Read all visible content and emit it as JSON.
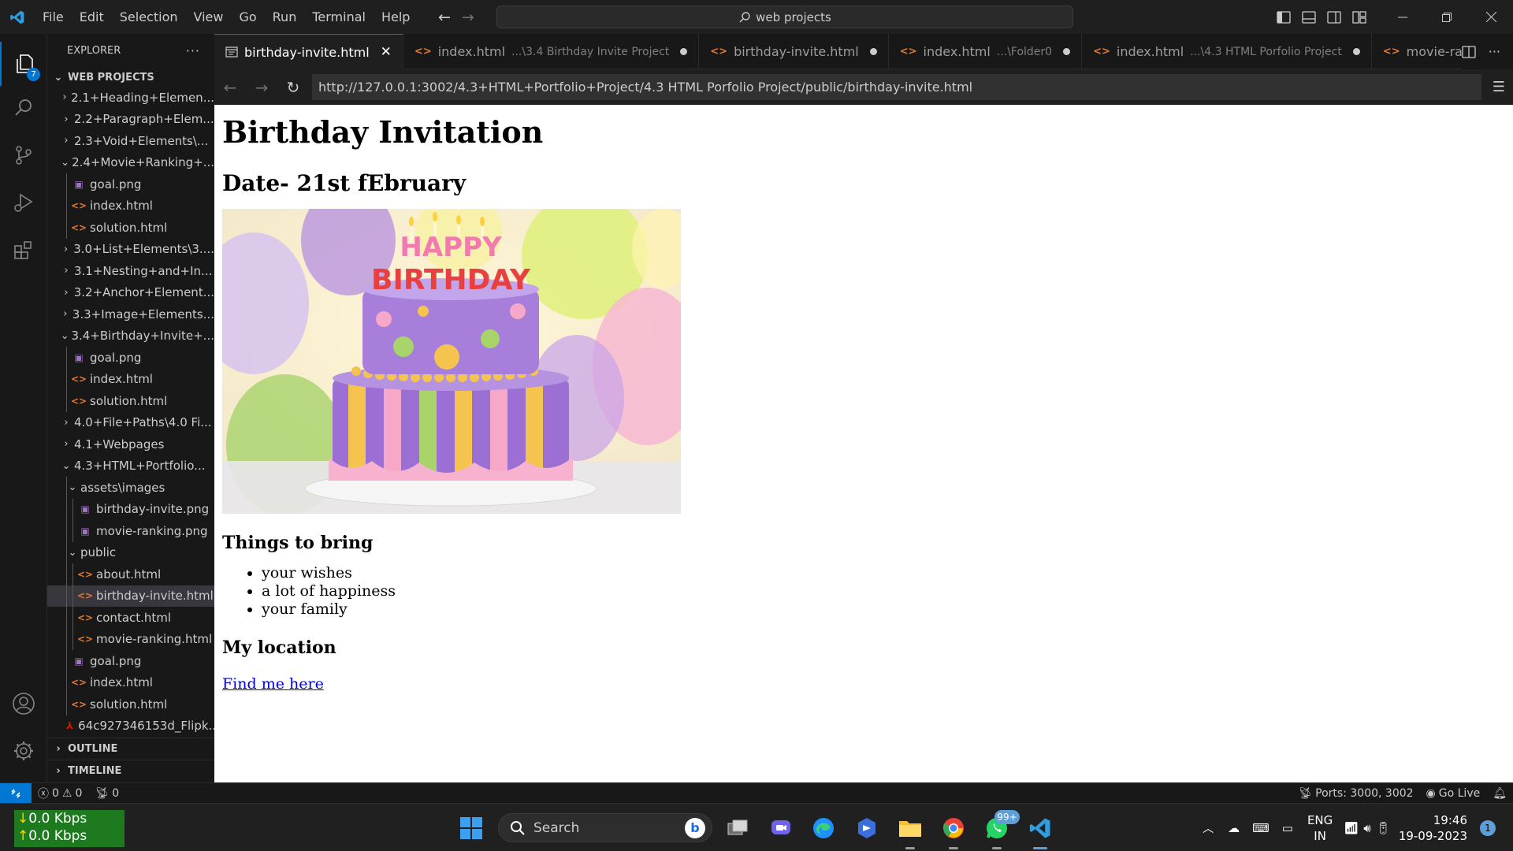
{
  "titlebar": {
    "menu": [
      "File",
      "Edit",
      "Selection",
      "View",
      "Go",
      "Run",
      "Terminal",
      "Help"
    ],
    "search_text": "web projects"
  },
  "activity": {
    "explorer_badge": "7"
  },
  "sidebar": {
    "title": "EXPLORER",
    "root": "WEB PROJECTS",
    "tree": [
      {
        "label": "2.1+Heading+Elemen...",
        "type": "folder",
        "open": false,
        "depth": 0
      },
      {
        "label": "2.2+Paragraph+Elem...",
        "type": "folder",
        "open": false,
        "depth": 0
      },
      {
        "label": "2.3+Void+Elements\\...",
        "type": "folder",
        "open": false,
        "depth": 0
      },
      {
        "label": "2.4+Movie+Ranking+...",
        "type": "folder",
        "open": true,
        "depth": 0
      },
      {
        "label": "goal.png",
        "type": "png",
        "depth": 1
      },
      {
        "label": "index.html",
        "type": "html",
        "depth": 1
      },
      {
        "label": "solution.html",
        "type": "html",
        "depth": 1
      },
      {
        "label": "3.0+List+Elements\\3....",
        "type": "folder",
        "open": false,
        "depth": 0
      },
      {
        "label": "3.1+Nesting+and+In...",
        "type": "folder",
        "open": false,
        "depth": 0
      },
      {
        "label": "3.2+Anchor+Element...",
        "type": "folder",
        "open": false,
        "depth": 0
      },
      {
        "label": "3.3+Image+Elements...",
        "type": "folder",
        "open": false,
        "depth": 0
      },
      {
        "label": "3.4+Birthday+Invite+...",
        "type": "folder",
        "open": true,
        "depth": 0
      },
      {
        "label": "goal.png",
        "type": "png",
        "depth": 1
      },
      {
        "label": "index.html",
        "type": "html",
        "depth": 1
      },
      {
        "label": "solution.html",
        "type": "html",
        "depth": 1
      },
      {
        "label": "4.0+File+Paths\\4.0 Fi...",
        "type": "folder",
        "open": false,
        "depth": 0
      },
      {
        "label": "4.1+Webpages",
        "type": "folder",
        "open": false,
        "depth": 0
      },
      {
        "label": "4.3+HTML+Portfolio...",
        "type": "folder",
        "open": true,
        "depth": 0
      },
      {
        "label": "assets\\images",
        "type": "folder",
        "open": true,
        "depth": 1
      },
      {
        "label": "birthday-invite.png",
        "type": "png",
        "depth": 2
      },
      {
        "label": "movie-ranking.png",
        "type": "png",
        "depth": 2
      },
      {
        "label": "public",
        "type": "folder",
        "open": true,
        "depth": 1
      },
      {
        "label": "about.html",
        "type": "html",
        "depth": 2
      },
      {
        "label": "birthday-invite.html",
        "type": "html",
        "depth": 2,
        "selected": true
      },
      {
        "label": "contact.html",
        "type": "html",
        "depth": 2
      },
      {
        "label": "movie-ranking.html",
        "type": "html",
        "depth": 2
      },
      {
        "label": "goal.png",
        "type": "png",
        "depth": 1
      },
      {
        "label": "index.html",
        "type": "html",
        "depth": 1
      },
      {
        "label": "solution.html",
        "type": "html",
        "depth": 1
      },
      {
        "label": "64c927346153d_Flipk...",
        "type": "pdf",
        "depth": 0
      }
    ],
    "outline": "OUTLINE",
    "timeline": "TIMELINE"
  },
  "tabs": [
    {
      "label": "birthday-invite.html",
      "desc": "",
      "active": true,
      "icon": "preview-icon"
    },
    {
      "label": "index.html",
      "desc": "...\\3.4 Birthday Invite Project",
      "active": false,
      "icon": "html-icon"
    },
    {
      "label": "birthday-invite.html",
      "desc": "",
      "active": false,
      "icon": "html-icon"
    },
    {
      "label": "index.html",
      "desc": "...\\Folder0",
      "active": false,
      "icon": "html-icon"
    },
    {
      "label": "index.html",
      "desc": "...\\4.3 HTML Porfolio Project",
      "active": false,
      "icon": "html-icon"
    },
    {
      "label": "movie-ranking.html",
      "desc": "",
      "active": false,
      "icon": "html-icon"
    }
  ],
  "browser": {
    "url": "http://127.0.0.1:3002/4.3+HTML+Portfolio+Project/4.3 HTML Porfolio Project/public/birthday-invite.html"
  },
  "page": {
    "h1": "Birthday Invitation",
    "date": "Date- 21st fEbruary",
    "bring_heading": "Things to bring",
    "bring_items": [
      "your wishes",
      "a lot of happiness",
      "your family"
    ],
    "location_heading": "My location",
    "link_text": "Find me here",
    "cake_topper": "HAPPY BIRTHDAY"
  },
  "statusbar": {
    "errors": "0",
    "warnings": "0",
    "ports_count": "0",
    "ports": "Ports: 3000, 3002",
    "golive": "Go Live"
  },
  "taskbar": {
    "net_down": "0.0 Kbps",
    "net_up": "0.0 Kbps",
    "search": "Search",
    "wa_badge": "99+",
    "lang1": "ENG",
    "lang2": "IN",
    "time": "19:46",
    "date": "19-09-2023",
    "notifications": "1"
  },
  "colors": {
    "accent": "#0078d4",
    "html_icon": "#e37933",
    "png_icon": "#a074c4"
  }
}
